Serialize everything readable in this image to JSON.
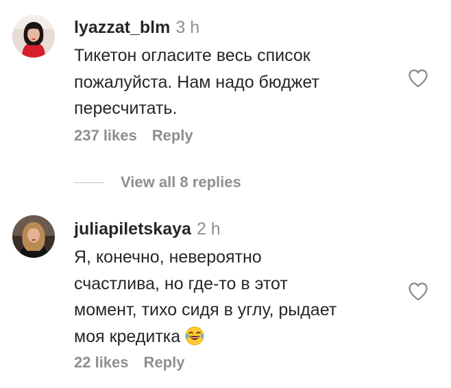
{
  "comments": [
    {
      "username": "lyazzat_blm",
      "time": "3 h",
      "text_lines": [
        "Тикетон огласите весь список",
        "пожалуйста. Нам надо бюджет",
        "пересчитать."
      ],
      "likes": "237 likes",
      "reply": "Reply",
      "like_icon": "heart-outline-icon"
    },
    {
      "username": "juliapiletskaya",
      "time": "2 h",
      "text_lines": [
        "Я, конечно, невероятно",
        "счастлива, но где-то в этот",
        "момент, тихо сидя в углу, рыдает",
        "моя кредитка"
      ],
      "emoji": "😂",
      "likes": "22 likes",
      "reply": "Reply",
      "like_icon": "heart-outline-icon"
    }
  ],
  "view_replies": "View all 8 replies",
  "colors": {
    "text": "#262626",
    "secondary": "#8e8e8e",
    "divider": "#c7c7c7",
    "background": "#ffffff"
  }
}
